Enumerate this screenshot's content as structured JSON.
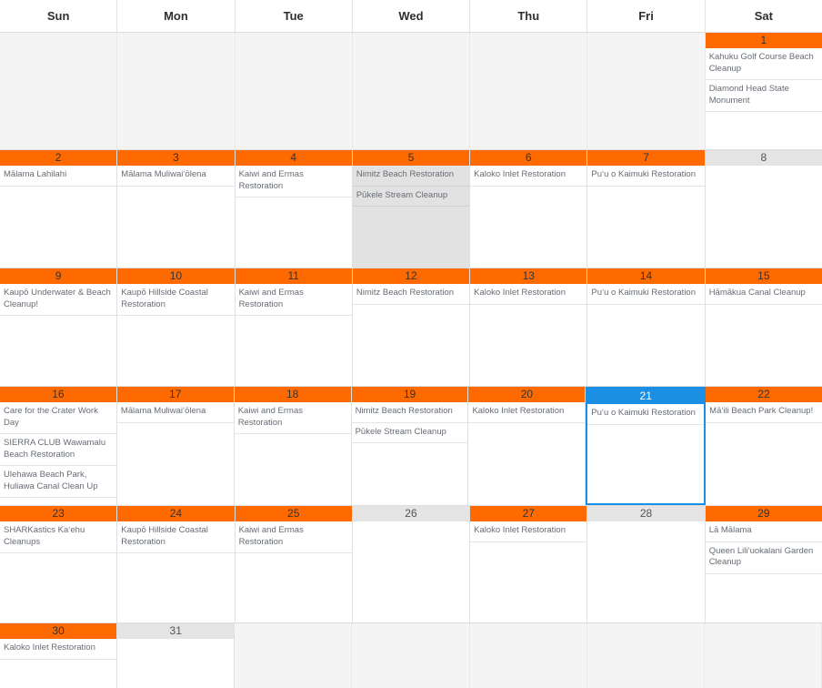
{
  "calendar": {
    "accent_color": "#ff6a00",
    "selected_color": "#1a8fe3",
    "muted_color": "#e4e4e4",
    "weekdays": [
      {
        "label": "Sun"
      },
      {
        "label": "Mon"
      },
      {
        "label": "Tue"
      },
      {
        "label": "Wed"
      },
      {
        "label": "Thu"
      },
      {
        "label": "Fri"
      },
      {
        "label": "Sat"
      }
    ],
    "weeks": [
      {
        "days": [
          {
            "number": "",
            "state": "blank",
            "events": []
          },
          {
            "number": "",
            "state": "blank",
            "events": []
          },
          {
            "number": "",
            "state": "blank",
            "events": []
          },
          {
            "number": "",
            "state": "blank",
            "events": []
          },
          {
            "number": "",
            "state": "blank",
            "events": []
          },
          {
            "number": "",
            "state": "blank",
            "events": []
          },
          {
            "number": "1",
            "state": "active",
            "events": [
              {
                "title": "Kahuku Golf Course Beach Cleanup"
              },
              {
                "title": "Diamond Head State Monument"
              }
            ]
          }
        ]
      },
      {
        "days": [
          {
            "number": "2",
            "state": "active",
            "events": [
              {
                "title": "Mālama Lahilahi"
              }
            ]
          },
          {
            "number": "3",
            "state": "active",
            "events": [
              {
                "title": "Mālama Muliwaiʻōlena"
              }
            ]
          },
          {
            "number": "4",
            "state": "active",
            "events": [
              {
                "title": "Kaiwi and Ermas Restoration"
              }
            ]
          },
          {
            "number": "5",
            "state": "hovered",
            "events": [
              {
                "title": "Nimitz Beach Restoration"
              },
              {
                "title": "Pūkele Stream Cleanup"
              }
            ]
          },
          {
            "number": "6",
            "state": "active",
            "events": [
              {
                "title": "Kaloko Inlet Restoration"
              }
            ]
          },
          {
            "number": "7",
            "state": "active",
            "events": [
              {
                "title": "Puʻu o Kaimuki Restoration"
              }
            ]
          },
          {
            "number": "8",
            "state": "muted",
            "events": []
          }
        ]
      },
      {
        "days": [
          {
            "number": "9",
            "state": "active",
            "events": [
              {
                "title": "Kaupō Underwater & Beach Cleanup!"
              }
            ]
          },
          {
            "number": "10",
            "state": "active",
            "events": [
              {
                "title": "Kaupō Hillside Coastal Restoration"
              }
            ]
          },
          {
            "number": "11",
            "state": "active",
            "events": [
              {
                "title": "Kaiwi and Ermas Restoration"
              }
            ]
          },
          {
            "number": "12",
            "state": "active",
            "events": [
              {
                "title": "Nimitz Beach Restoration"
              }
            ]
          },
          {
            "number": "13",
            "state": "active",
            "events": [
              {
                "title": "Kaloko Inlet Restoration"
              }
            ]
          },
          {
            "number": "14",
            "state": "active",
            "events": [
              {
                "title": "Puʻu o Kaimuki Restoration"
              }
            ]
          },
          {
            "number": "15",
            "state": "active",
            "events": [
              {
                "title": "Hāmākua Canal Cleanup"
              }
            ]
          }
        ]
      },
      {
        "days": [
          {
            "number": "16",
            "state": "active",
            "events": [
              {
                "title": "Care for the Crater Work Day"
              },
              {
                "title": "SIERRA CLUB Wawamalu Beach Restoration"
              },
              {
                "title": "Ulehawa Beach Park, Huliawa Canal Clean Up"
              }
            ]
          },
          {
            "number": "17",
            "state": "active",
            "events": [
              {
                "title": "Mālama Muliwaiʻōlena"
              }
            ]
          },
          {
            "number": "18",
            "state": "active",
            "events": [
              {
                "title": "Kaiwi and Ermas Restoration"
              }
            ]
          },
          {
            "number": "19",
            "state": "active",
            "events": [
              {
                "title": "Nimitz Beach Restoration"
              },
              {
                "title": "Pūkele Stream Cleanup"
              }
            ]
          },
          {
            "number": "20",
            "state": "active",
            "events": [
              {
                "title": "Kaloko Inlet Restoration"
              }
            ]
          },
          {
            "number": "21",
            "state": "selected",
            "events": [
              {
                "title": "Puʻu o Kaimuki Restoration"
              }
            ]
          },
          {
            "number": "22",
            "state": "active",
            "events": [
              {
                "title": "Māʻili Beach Park Cleanup!"
              }
            ]
          }
        ]
      },
      {
        "days": [
          {
            "number": "23",
            "state": "active",
            "events": [
              {
                "title": "SHARKastics Kaʻehu Cleanups"
              }
            ]
          },
          {
            "number": "24",
            "state": "active",
            "events": [
              {
                "title": "Kaupō Hillside Coastal Restoration"
              }
            ]
          },
          {
            "number": "25",
            "state": "active",
            "events": [
              {
                "title": "Kaiwi and Ermas Restoration"
              }
            ]
          },
          {
            "number": "26",
            "state": "muted",
            "events": []
          },
          {
            "number": "27",
            "state": "active",
            "events": [
              {
                "title": "Kaloko Inlet Restoration"
              }
            ]
          },
          {
            "number": "28",
            "state": "muted",
            "events": []
          },
          {
            "number": "29",
            "state": "active",
            "events": [
              {
                "title": "Lā Mālama"
              },
              {
                "title": "Queen Liliʻuokalani Garden Cleanup"
              }
            ]
          }
        ]
      },
      {
        "days": [
          {
            "number": "30",
            "state": "active",
            "events": [
              {
                "title": "Kaloko Inlet Restoration"
              }
            ]
          },
          {
            "number": "31",
            "state": "muted",
            "events": []
          },
          {
            "number": "",
            "state": "blank",
            "events": []
          },
          {
            "number": "",
            "state": "blank",
            "events": []
          },
          {
            "number": "",
            "state": "blank",
            "events": []
          },
          {
            "number": "",
            "state": "blank",
            "events": []
          },
          {
            "number": "",
            "state": "blank",
            "events": []
          }
        ]
      }
    ]
  }
}
